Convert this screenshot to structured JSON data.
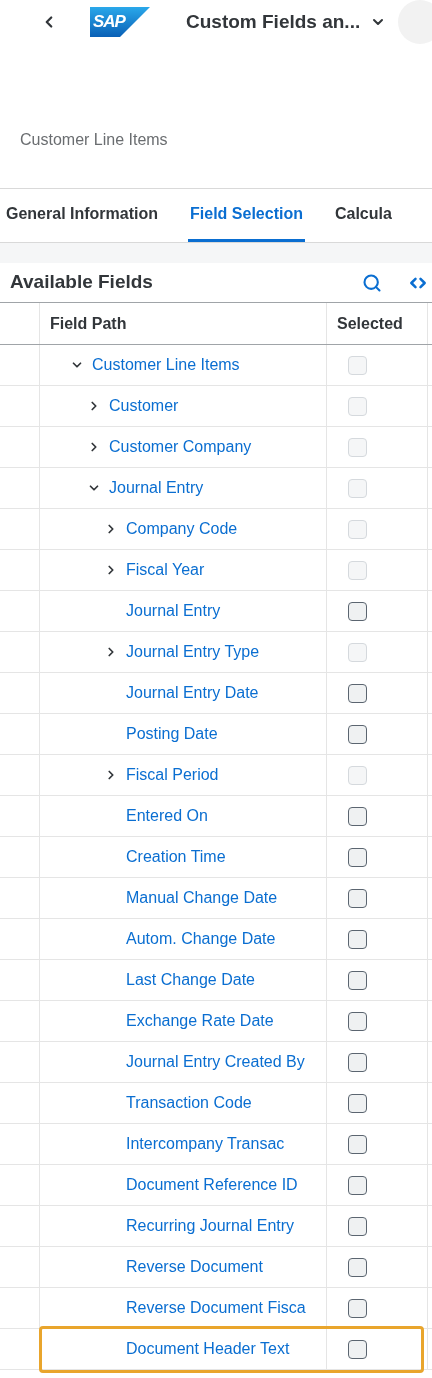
{
  "header": {
    "logo_text": "SAP",
    "title": "Custom Fields an..."
  },
  "subtitle": "Customer Line Items",
  "tabs": [
    {
      "label": "General Information",
      "selected": false
    },
    {
      "label": "Field Selection",
      "selected": true
    },
    {
      "label": "Calcula",
      "selected": false
    }
  ],
  "panel": {
    "title": "Available Fields"
  },
  "table": {
    "columns": [
      "Field Path",
      "Selected"
    ],
    "tree": [
      {
        "kind": "group",
        "label": "Customer Line Items",
        "expanded": true,
        "checked": false,
        "disabled": true,
        "focused": false,
        "children": [
          {
            "kind": "group",
            "label": "Customer",
            "expanded": false,
            "checked": false,
            "disabled": true,
            "focused": false
          },
          {
            "kind": "group",
            "label": "Customer Company",
            "expanded": false,
            "checked": false,
            "disabled": true,
            "focused": false
          },
          {
            "kind": "group",
            "label": "Journal Entry",
            "expanded": true,
            "checked": false,
            "disabled": true,
            "focused": false,
            "children": [
              {
                "kind": "group",
                "label": "Company Code",
                "expanded": false,
                "checked": false,
                "disabled": true,
                "focused": false
              },
              {
                "kind": "group",
                "label": "Fiscal Year",
                "expanded": false,
                "checked": false,
                "disabled": true,
                "focused": false
              },
              {
                "kind": "field",
                "label": "Journal Entry",
                "checked": false,
                "disabled": false,
                "focused": false
              },
              {
                "kind": "group",
                "label": "Journal Entry Type",
                "expanded": false,
                "checked": false,
                "disabled": true,
                "focused": false
              },
              {
                "kind": "field",
                "label": "Journal Entry Date",
                "checked": false,
                "disabled": false,
                "focused": false
              },
              {
                "kind": "field",
                "label": "Posting Date",
                "checked": false,
                "disabled": false,
                "focused": false
              },
              {
                "kind": "group",
                "label": "Fiscal Period",
                "expanded": false,
                "checked": false,
                "disabled": true,
                "focused": false
              },
              {
                "kind": "field",
                "label": "Entered On",
                "checked": false,
                "disabled": false,
                "focused": false
              },
              {
                "kind": "field",
                "label": "Creation Time",
                "checked": false,
                "disabled": false,
                "focused": false
              },
              {
                "kind": "field",
                "label": "Manual Change Date",
                "checked": false,
                "disabled": false,
                "focused": false
              },
              {
                "kind": "field",
                "label": "Autom. Change Date",
                "checked": false,
                "disabled": false,
                "focused": false
              },
              {
                "kind": "field",
                "label": "Last Change Date",
                "checked": false,
                "disabled": false,
                "focused": false
              },
              {
                "kind": "field",
                "label": "Exchange Rate Date",
                "checked": false,
                "disabled": false,
                "focused": false
              },
              {
                "kind": "field",
                "label": "Journal Entry Created By",
                "checked": false,
                "disabled": false,
                "focused": false
              },
              {
                "kind": "field",
                "label": "Transaction Code",
                "checked": false,
                "disabled": false,
                "focused": false
              },
              {
                "kind": "field",
                "label": "Intercompany Transac",
                "checked": false,
                "disabled": false,
                "focused": false
              },
              {
                "kind": "field",
                "label": "Document Reference ID",
                "checked": false,
                "disabled": false,
                "focused": false
              },
              {
                "kind": "field",
                "label": "Recurring Journal Entry",
                "checked": false,
                "disabled": false,
                "focused": false
              },
              {
                "kind": "field",
                "label": "Reverse Document",
                "checked": false,
                "disabled": false,
                "focused": false
              },
              {
                "kind": "field",
                "label": "Reverse Document Fisca",
                "checked": false,
                "disabled": false,
                "focused": false
              },
              {
                "kind": "field",
                "label": "Document Header Text",
                "checked": false,
                "disabled": false,
                "focused": true
              }
            ]
          }
        ]
      }
    ]
  }
}
